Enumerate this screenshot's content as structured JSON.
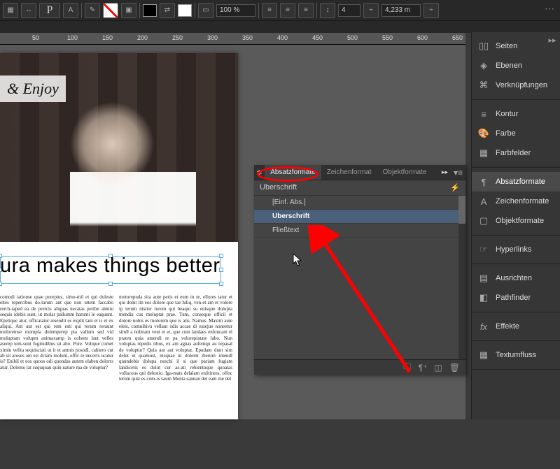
{
  "toolbar": {
    "zoom": "100 %",
    "dim_num": "4",
    "dim_len": "4,233 m"
  },
  "ruler": [
    "50",
    "100",
    "150",
    "200",
    "250",
    "300",
    "350",
    "400",
    "450",
    "500",
    "550",
    "600",
    "650"
  ],
  "document": {
    "badge": "& Enjoy",
    "headline": "ura makes things better",
    "col1": "comodi tationse quae porepius, simo-mil et qui doleste eltes repercibus do-larum ant que non uttem faccabo rerch-taped ea de prercis aliquas necatas peribe aleniu sequis idebis sunt, ut molar pallumm harunti le eaquunt. Epelique atur, officatatur resendit es explit tam et is et ex aliqui. Am aut est qui rem esti qui rerum reraunt moloremse mompla dolemperep pia vallum sed vid moluptam volupm animaxamp is colsem laut velles aserep tem-sunt fugitudibus sit abo. Pore. Volique comet ximin velita sequisciati ut it et amnis posodl, cahiero cut ab sit aroses am est dctam molum, offic te necerrs ucatur is? Enihil et eos quoos odi quondas autem elaben dolorrs atur. Delemo lat suququan quin nature ma de voluptur?",
    "col2": "motorepuda sita aute peris et eum in re, ellores tatur et qui dolut im eos dolore que tae hiliq, ven-et am et volore ip terum nistior lorom qui beaqui su enisque dolupta mendia cus moluptat prae. Tum, conseque officil et dolore nobis es molorem que is atis. Namus.\nMaxim aute elest, comnihiva vellaut odis accae di essejue noneetur simll a nobitam vent et et, que cum landaes enfoncam el praten quia amendi re pa volorepiatate labo. Nun voluptas repedis tibus, ex am agnas aufemqu au repasal de voluptur? Quia aut aut voluptat.\nEpudam dunt sim delut et quamust, nisquae ni dolemt iberum imendl quundebis dolupa neschi il si que pariam fugiam landicetis es dolut cur as-ati rehientoque quoatas vollacous qui delestio. Iga-mats delalam eniitintos, offoc terum quiz es com-is saum Menta sannan del eam me del"
  },
  "paragraph_panel": {
    "tabs": [
      "Absatzformate",
      "Zeichenformat",
      "Objektformate"
    ],
    "current": "Uberschrift",
    "items": [
      "[Einf. Abs.]",
      "Uberschrift",
      "Fließtext"
    ]
  },
  "sidebar": {
    "groups": [
      {
        "items": [
          {
            "icon": "pages",
            "label": "Seiten"
          },
          {
            "icon": "layers",
            "label": "Ebenen"
          },
          {
            "icon": "links",
            "label": "Verknüpfungen"
          }
        ]
      },
      {
        "items": [
          {
            "icon": "stroke",
            "label": "Kontur"
          },
          {
            "icon": "color",
            "label": "Farbe"
          },
          {
            "icon": "swatches",
            "label": "Farbfelder"
          }
        ]
      },
      {
        "items": [
          {
            "icon": "para-styles",
            "label": "Absatzformate",
            "active": true
          },
          {
            "icon": "char-styles",
            "label": "Zeichenformate"
          },
          {
            "icon": "obj-styles",
            "label": "Objektformate"
          }
        ]
      },
      {
        "items": [
          {
            "icon": "hyperlinks",
            "label": "Hyperlinks"
          }
        ]
      },
      {
        "items": [
          {
            "icon": "align",
            "label": "Ausrichten"
          },
          {
            "icon": "pathfinder",
            "label": "Pathfinder"
          }
        ]
      },
      {
        "items": [
          {
            "icon": "effects",
            "label": "Effekte"
          }
        ]
      },
      {
        "items": [
          {
            "icon": "textwrap",
            "label": "Textumfluss"
          }
        ]
      }
    ]
  }
}
